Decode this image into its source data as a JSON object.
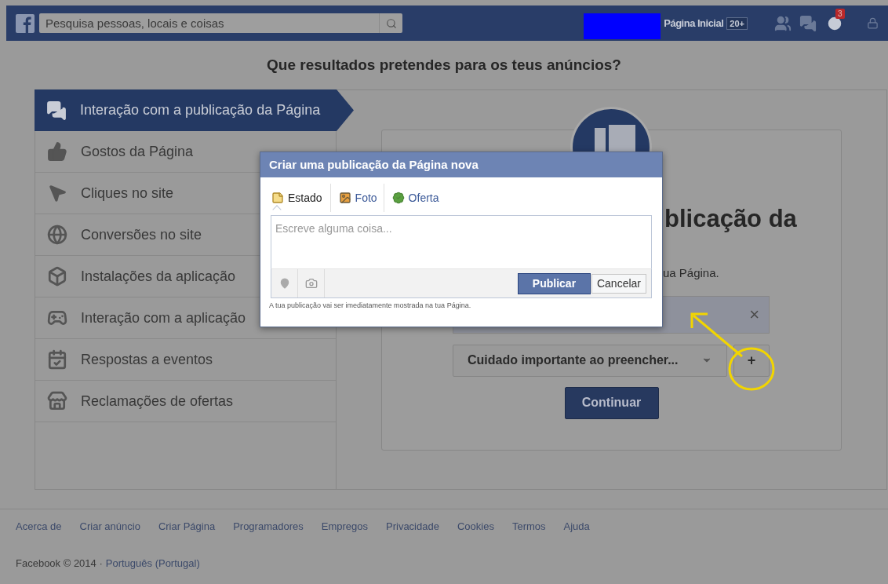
{
  "top_bar": {
    "search": {
      "placeholder": "Pesquisa pessoas, locais e coisas"
    },
    "home_link": "Página Inicial",
    "home_count": "20+",
    "notification_count": "3"
  },
  "heading": "Que resultados pretendes para os teus anúncios?",
  "sidebar": {
    "items": [
      {
        "label": "Interação com a publicação da Página",
        "selected": true
      },
      {
        "label": "Gostos da Página",
        "selected": false
      },
      {
        "label": "Cliques no site",
        "selected": false
      },
      {
        "label": "Conversões no site",
        "selected": false
      },
      {
        "label": "Instalações da aplicação",
        "selected": false
      },
      {
        "label": "Interação com a aplicação",
        "selected": false
      },
      {
        "label": "Respostas a eventos",
        "selected": false
      },
      {
        "label": "Reclamações de ofertas",
        "selected": false
      }
    ]
  },
  "card": {
    "title": "blicação da",
    "description": "ua Página.",
    "close": "×",
    "dropdown": "Cuidado importante ao preencher...",
    "add_button": "+",
    "continue_button": "Continuar"
  },
  "dialog": {
    "title": "Criar uma publicação da Página nova",
    "tabs": [
      {
        "label": "Estado",
        "selected": true
      },
      {
        "label": "Foto",
        "selected": false
      },
      {
        "label": "Oferta",
        "selected": false
      }
    ],
    "placeholder": "Escreve alguma coisa...",
    "publish_button": "Publicar",
    "cancel_button": "Cancelar",
    "note": "A tua publicação vai ser imediatamente mostrada na tua Página."
  },
  "footer": {
    "links": [
      "Acerca de",
      "Criar anúncio",
      "Criar Página",
      "Programadores",
      "Empregos",
      "Privacidade",
      "Cookies",
      "Termos",
      "Ajuda"
    ],
    "copyright": "Facebook © 2014 ·",
    "language": "Português (Portugal)"
  }
}
